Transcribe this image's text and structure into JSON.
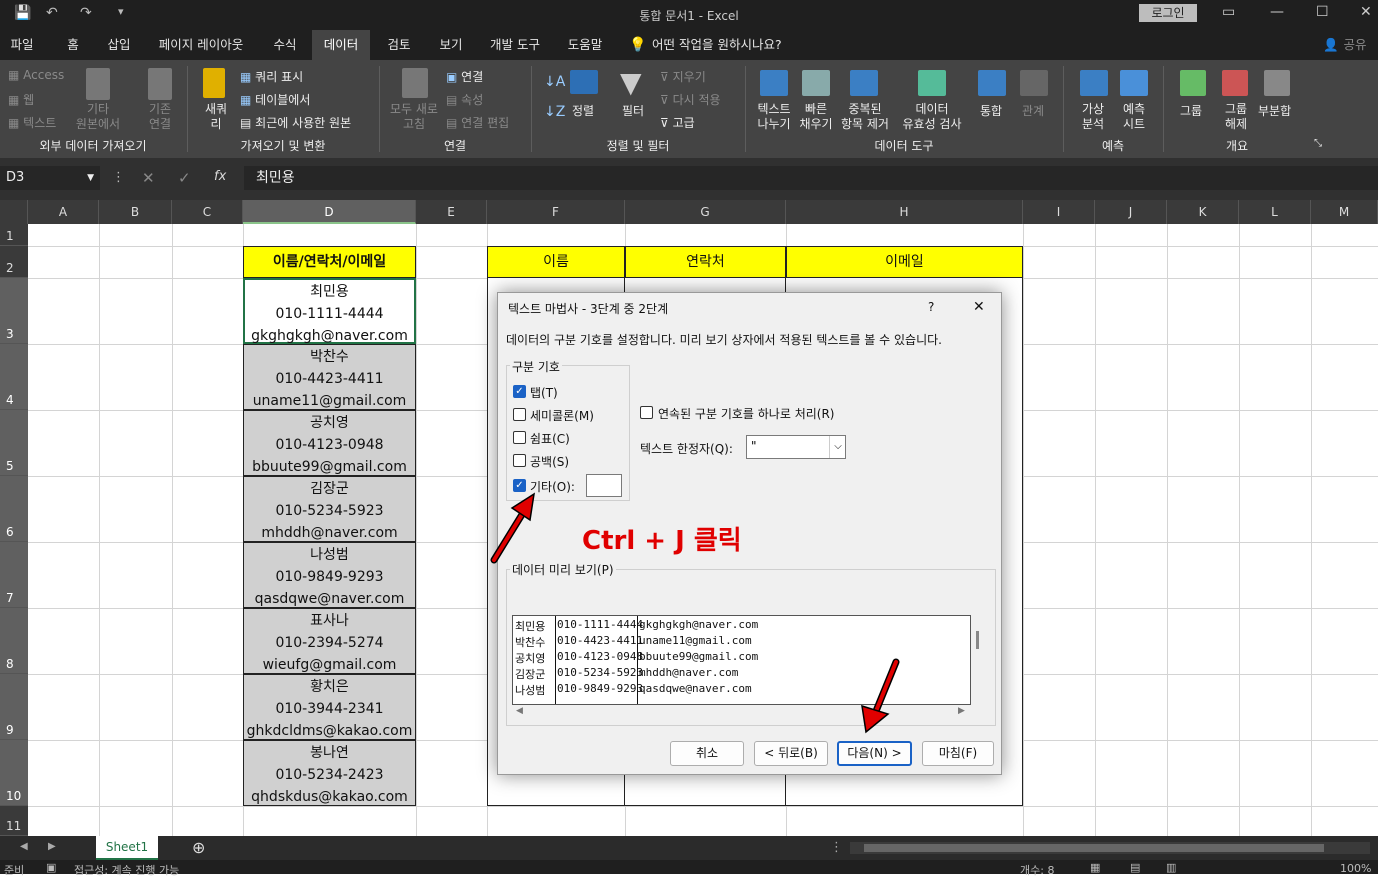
{
  "window": {
    "title": "통합 문서1  -  Excel",
    "login": "로그인"
  },
  "tabs": [
    "파일",
    "홈",
    "삽입",
    "페이지 레이아웃",
    "수식",
    "데이터",
    "검토",
    "보기",
    "개발 도구",
    "도움말"
  ],
  "tell_me": "어떤 작업을 원하시나요?",
  "share": "공유",
  "ribbon": {
    "ext": {
      "access": "Access",
      "web": "웹",
      "text": "텍스트",
      "other": "기타\n원본에서",
      "existing": "기존\n연결",
      "label": "외부 데이터 가져오기"
    },
    "get": {
      "new_query": "새쿼\n리",
      "show_query": "쿼리 표시",
      "from_table": "테이블에서",
      "recent": "최근에 사용한 원본",
      "label": "가져오기 및 변환"
    },
    "conn": {
      "refresh_all": "모두 새로\n고침",
      "connections": "연결",
      "properties": "속성",
      "edit_links": "연결 편집",
      "label": "연결"
    },
    "sort": {
      "sort": "정렬",
      "filter": "필터",
      "clear": "지우기",
      "reapply": "다시 적용",
      "advanced": "고급",
      "label": "정렬 및 필터"
    },
    "tools": {
      "text_to_cols": "텍스트\n나누기",
      "flash": "빠른\n채우기",
      "dup": "중복된\n항목 제거",
      "valid": "데이터\n유효성 검사",
      "consolidate": "통합",
      "relations": "관계",
      "label": "데이터 도구"
    },
    "forecast": {
      "whatif": "가상\n분석",
      "sheet": "예측\n시트",
      "label": "예측"
    },
    "outline": {
      "group": "그룹",
      "ungroup": "그룹\n해제",
      "subtotal": "부분합",
      "label": "개요"
    }
  },
  "formula_bar": {
    "name_box": "D3",
    "formula": "최민용"
  },
  "columns": [
    "A",
    "B",
    "C",
    "D",
    "E",
    "F",
    "G",
    "H",
    "I",
    "J",
    "K",
    "L",
    "M"
  ],
  "rows": [
    "1",
    "2",
    "3",
    "4",
    "5",
    "6",
    "7",
    "8",
    "9",
    "10",
    "11"
  ],
  "sheet": {
    "d_header": "이름/연락처/이메일",
    "entries": [
      {
        "name": "최민용",
        "phone": "010-1111-4444",
        "email": "gkghgkgh@naver.com"
      },
      {
        "name": "박찬수",
        "phone": "010-4423-4411",
        "email": "uname11@gmail.com"
      },
      {
        "name": "공치영",
        "phone": "010-4123-0948",
        "email": "bbuute99@gmail.com"
      },
      {
        "name": "김장군",
        "phone": "010-5234-5923",
        "email": "mhddh@naver.com"
      },
      {
        "name": "나성범",
        "phone": "010-9849-9293",
        "email": "qasdqwe@naver.com"
      },
      {
        "name": "표사나",
        "phone": "010-2394-5274",
        "email": "wieufg@gmail.com"
      },
      {
        "name": "황치은",
        "phone": "010-3944-2341",
        "email": "ghkdcldms@kakao.com"
      },
      {
        "name": "봉나연",
        "phone": "010-5234-2423",
        "email": "qhdskdus@kakao.com"
      }
    ],
    "table_headers": [
      "이름",
      "연락처",
      "이메일"
    ]
  },
  "dialog": {
    "title": "텍스트 마법사 - 3단계 중 2단계",
    "help": "?",
    "close": "✕",
    "desc": "데이터의 구분 기호를 설정합니다. 미리 보기 상자에서 적용된 텍스트를 볼 수 있습니다.",
    "delim_group": "구분 기호",
    "delims": [
      {
        "label": "탭(T)",
        "checked": true
      },
      {
        "label": "세미콜론(M)",
        "checked": false
      },
      {
        "label": "쉼표(C)",
        "checked": false
      },
      {
        "label": "공백(S)",
        "checked": false
      },
      {
        "label": "기타(O):",
        "checked": true
      }
    ],
    "consecutive": "연속된 구분 기호를 하나로 처리(R)",
    "qualifier_label": "텍스트 한정자(Q):",
    "qualifier_value": "\"",
    "preview_label": "데이터 미리 보기(P)",
    "preview_rows": [
      [
        "최민용",
        "010-1111-4444",
        "gkghgkgh@naver.com"
      ],
      [
        "박찬수",
        "010-4423-4411",
        "uname11@gmail.com"
      ],
      [
        "공치영",
        "010-4123-0948",
        "bbuute99@gmail.com"
      ],
      [
        "김장군",
        "010-5234-5923",
        "mhddh@naver.com"
      ],
      [
        "나성범",
        "010-9849-9293",
        "qasdqwe@naver.com"
      ]
    ],
    "buttons": {
      "cancel": "취소",
      "back": "< 뒤로(B)",
      "next": "다음(N) >",
      "finish": "마침(F)"
    }
  },
  "annotation": {
    "text": "Ctrl + J 클릭",
    "color": "#e00000"
  },
  "sheet_tab": "Sheet1",
  "status": {
    "ready": "준비",
    "accessibility": "접근성: 계속 진행 가능",
    "count": "개수: 8",
    "zoom": "100%"
  }
}
